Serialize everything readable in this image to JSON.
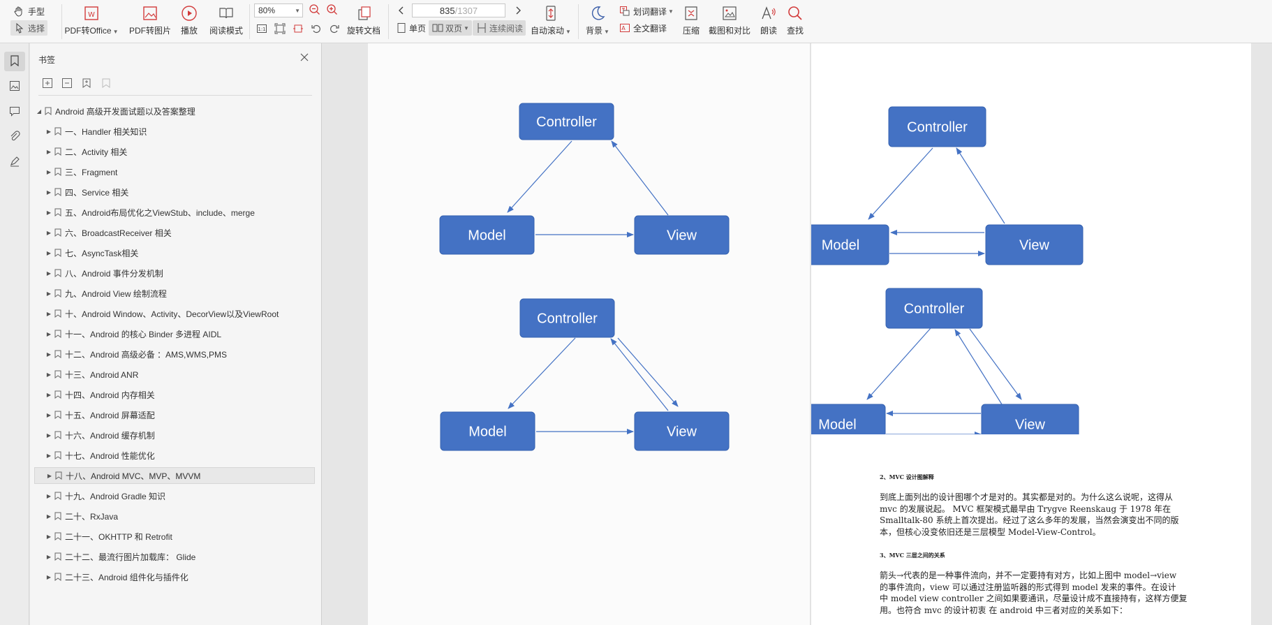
{
  "toolbar": {
    "hand": "手型",
    "select": "选择",
    "pdf_to_office": "PDF转Office",
    "pdf_to_image": "PDF转图片",
    "play": "播放",
    "read_mode": "阅读模式",
    "zoom": "80%",
    "rotate": "旋转文档",
    "page_current": "835",
    "page_total": "/1307",
    "single": "单页",
    "double": "双页",
    "continuous": "连续阅读",
    "auto_scroll": "自动滚动",
    "background": "背景",
    "word_translate": "划词翻译",
    "full_translate": "全文翻译",
    "compress": "压缩",
    "screenshot": "截图和对比",
    "read_aloud": "朗读",
    "find": "查找"
  },
  "panel": {
    "title": "书签",
    "root": "Android 高级开发面试题以及答案整理",
    "items": [
      "一、Handler 相关知识",
      "二、Activity 相关",
      "三、Fragment",
      "四、Service 相关",
      "五、Android布局优化之ViewStub、include、merge",
      "六、BroadcastReceiver 相关",
      "七、AsyncTask相关",
      "八、Android 事件分发机制",
      "九、Android View 绘制流程",
      "十、Android Window、Activity、DecorView以及ViewRoot",
      "十一、Android 的核心 Binder 多进程 AIDL",
      "十二、Android 高级必备 ：AMS,WMS,PMS",
      "十三、Android ANR",
      "十四、Android 内存相关",
      "十五、Android 屏幕适配",
      "十六、Android 缓存机制",
      "十七、Android 性能优化",
      "十八、Android MVC、MVP、MVVM",
      "十九、Android Gradle 知识",
      "二十、RxJava",
      "二十一、OKHTTP 和 Retrofit",
      "二十二、最流行图片加载库： Glide",
      "二十三、Android 组件化与插件化"
    ],
    "selected_index": 17
  },
  "diagram": {
    "controller": "Controller",
    "model": "Model",
    "view": "View",
    "box_color": "#4472c4",
    "arrow_color": "#4472c4"
  },
  "doc": {
    "heading2": "2、MVC 设计图解释",
    "para1": [
      "到底上面列出的设计图哪个才是对的。其实都是对的。为什么这么说呢，这得从",
      "mvc 的发展说起。  MVC 框架模式最早由 Trygve Reenskaug  于 1978 年在",
      "Smalltalk-80 系统上首次提出。经过了这么多年的发展，当然会演变出不同的版",
      "本，但核心没变依旧还是三层模型 Model-View-Control。"
    ],
    "heading3": "3、MVC 三层之间的关系",
    "para2": [
      "箭头→代表的是一种事件流向，并不一定要持有对方，比如上图中 model→view",
      "的事件流向，view 可以通过注册监听器的形式得到 model 发来的事件。在设计",
      "中 model view controller 之间如果要通讯，尽量设计成不直接持有，这样方便复",
      "用。也符合 mvc 的设计初衷  在 android 中三者对应的关系如下："
    ]
  }
}
